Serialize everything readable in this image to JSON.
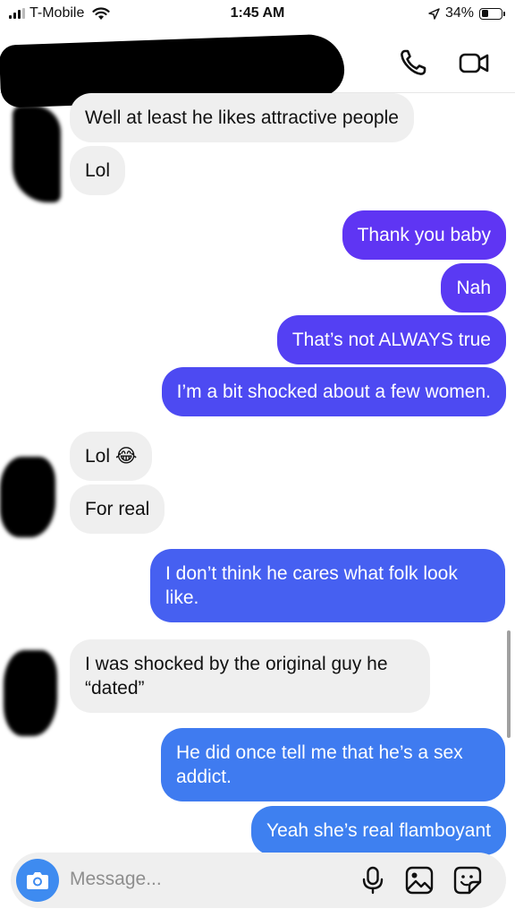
{
  "status_bar": {
    "carrier": "T-Mobile",
    "time": "1:45 AM",
    "battery": "34%",
    "battery_level": 0.34
  },
  "header": {
    "icons": [
      "chevron-left-icon",
      "phone-icon",
      "video-camera-icon"
    ]
  },
  "messages": [
    {
      "dir": "in",
      "text": "Well at least he likes attractive people"
    },
    {
      "dir": "in",
      "text": "Lol"
    },
    {
      "dir": "out",
      "text": "Thank you baby"
    },
    {
      "dir": "out",
      "text": "Nah"
    },
    {
      "dir": "out",
      "text": "That’s not ALWAYS true"
    },
    {
      "dir": "out",
      "text": "I’m a bit shocked about a few women."
    },
    {
      "dir": "in",
      "text": "Lol 😂"
    },
    {
      "dir": "in",
      "text": "For real"
    },
    {
      "dir": "out",
      "text": "I don’t think he cares what folk look like."
    },
    {
      "dir": "in",
      "text": "I was shocked by the original guy he “dated”"
    },
    {
      "dir": "out",
      "text": "He did once tell me that he’s a sex addict."
    },
    {
      "dir": "out",
      "text": "Yeah she’s real flamboyant"
    }
  ],
  "composer": {
    "placeholder": "Message...",
    "icons": [
      "camera-icon",
      "microphone-icon",
      "gallery-icon",
      "sticker-icon"
    ]
  },
  "colors": {
    "outgoing_top": "#5f35f3",
    "outgoing_bottom": "#3e7ff0",
    "incoming": "#efefef",
    "accent": "#3e8bf0"
  }
}
